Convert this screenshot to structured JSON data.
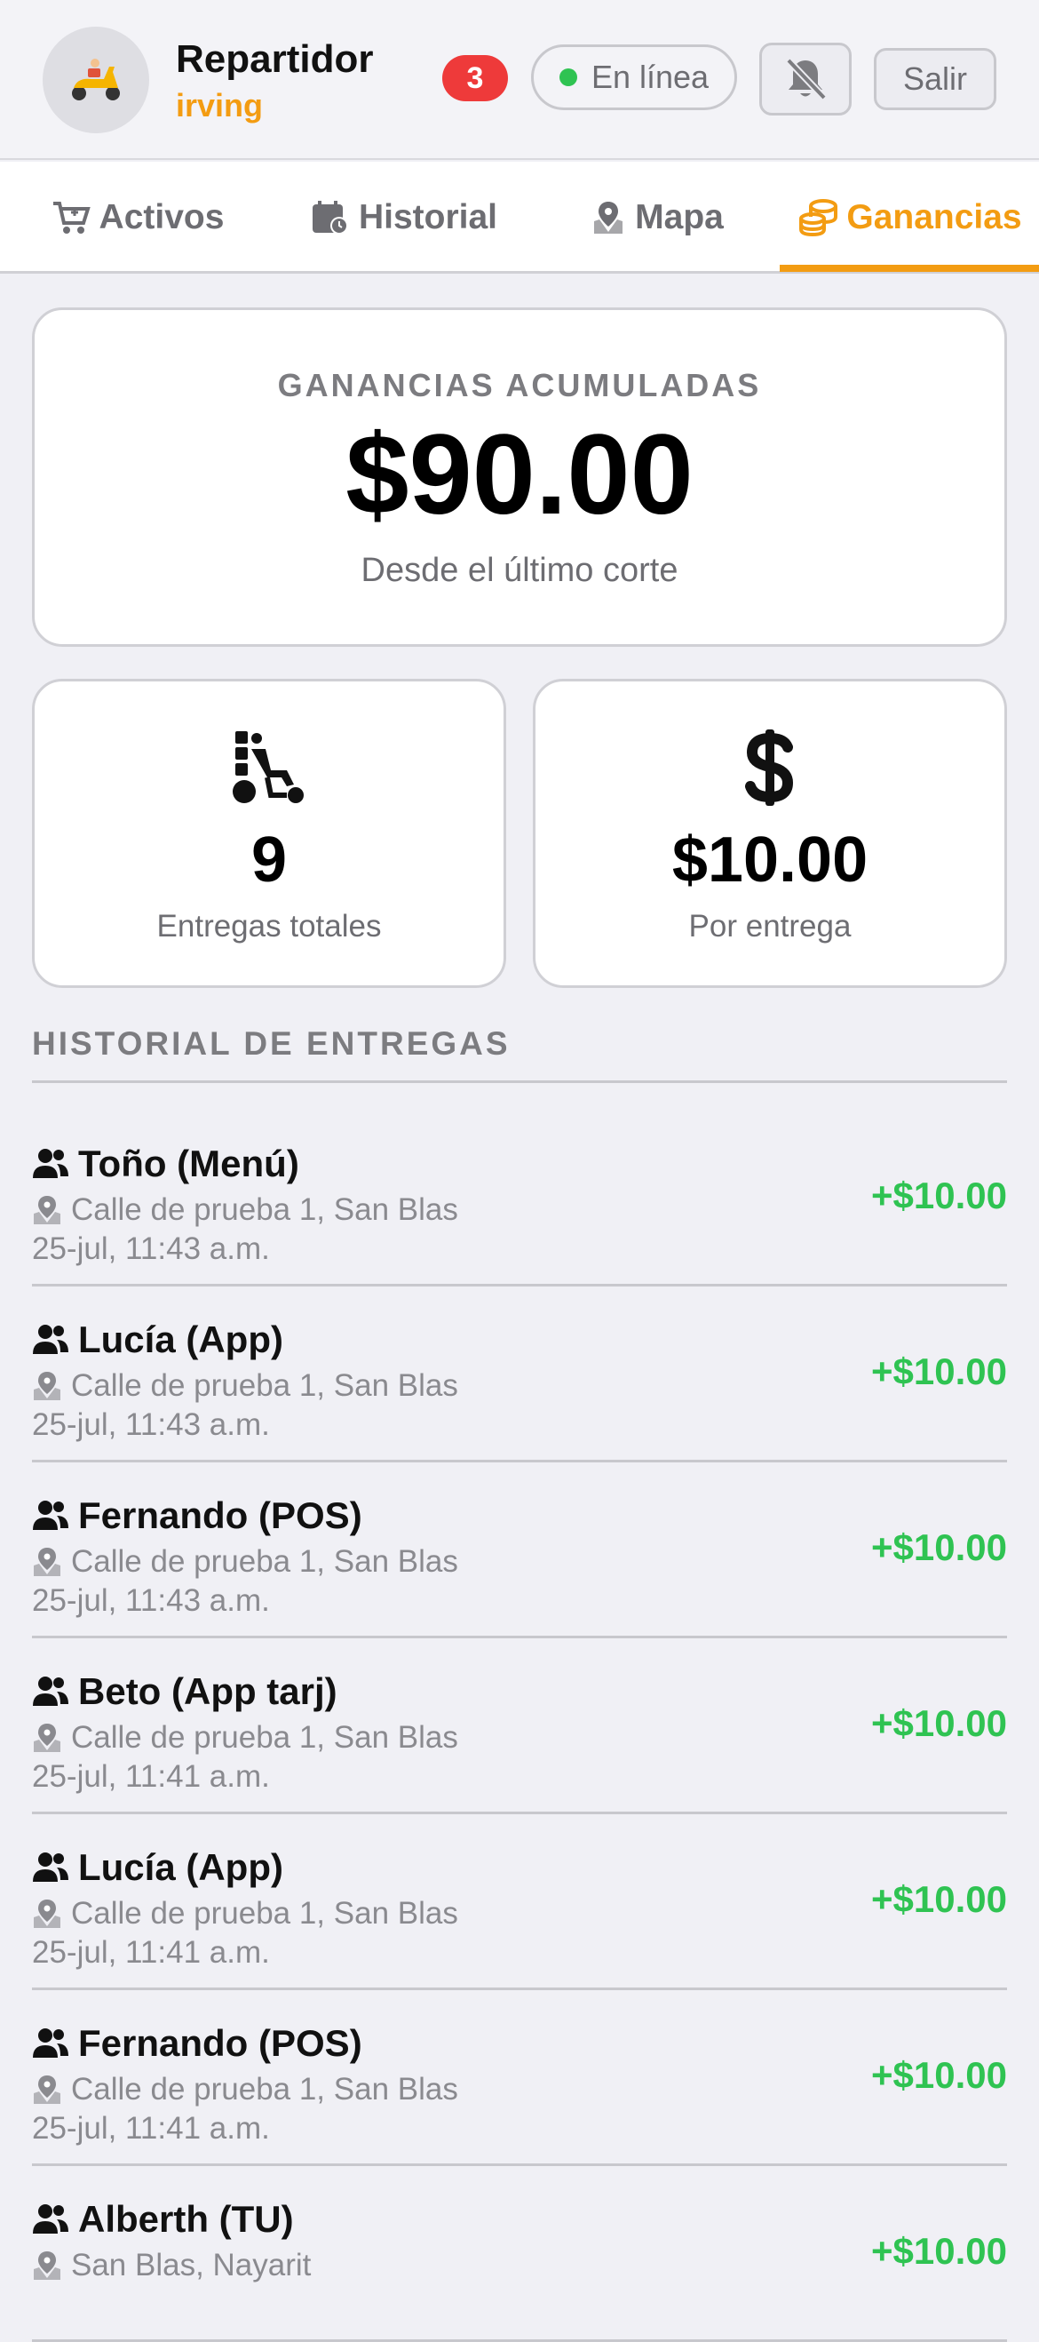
{
  "header": {
    "role": "Repartidor",
    "username": "irving",
    "notification_count": "3",
    "status": "En línea",
    "logout_label": "Salir",
    "colors": {
      "accent": "#f39c12",
      "online": "#2fc352",
      "badge": "#ee3a3a"
    }
  },
  "tabs": [
    {
      "label": "Activos",
      "icon": "cart-icon"
    },
    {
      "label": "Historial",
      "icon": "calendar-icon"
    },
    {
      "label": "Mapa",
      "icon": "map-pin-icon"
    },
    {
      "label": "Ganancias",
      "icon": "coins-icon",
      "active": true
    }
  ],
  "summary": {
    "label": "GANANCIAS ACUMULADAS",
    "amount": "$90.00",
    "subtitle": "Desde el último corte"
  },
  "stats": {
    "deliveries": {
      "value": "9",
      "label": "Entregas totales",
      "icon": "delivery-person-icon"
    },
    "per_delivery": {
      "value": "$10.00",
      "label": "Por entrega",
      "icon": "dollar-icon"
    }
  },
  "history": {
    "title": "HISTORIAL DE ENTREGAS",
    "items": [
      {
        "name": "Toño (Menú)",
        "address": "Calle de prueba 1, San Blas",
        "date": "25-jul, 11:43 a.m.",
        "amount": "+$10.00"
      },
      {
        "name": "Lucía (App)",
        "address": "Calle de prueba 1, San Blas",
        "date": "25-jul, 11:43 a.m.",
        "amount": "+$10.00"
      },
      {
        "name": "Fernando (POS)",
        "address": "Calle de prueba 1, San Blas",
        "date": "25-jul, 11:43 a.m.",
        "amount": "+$10.00"
      },
      {
        "name": "Beto (App tarj)",
        "address": "Calle de prueba 1, San Blas",
        "date": "25-jul, 11:41 a.m.",
        "amount": "+$10.00"
      },
      {
        "name": "Lucía (App)",
        "address": "Calle de prueba 1, San Blas",
        "date": "25-jul, 11:41 a.m.",
        "amount": "+$10.00"
      },
      {
        "name": "Fernando (POS)",
        "address": "Calle de prueba 1, San Blas",
        "date": "25-jul, 11:41 a.m.",
        "amount": "+$10.00"
      },
      {
        "name": "Alberth (TU)",
        "address": "San Blas, Nayarit",
        "date": "",
        "amount": "+$10.00"
      }
    ]
  }
}
